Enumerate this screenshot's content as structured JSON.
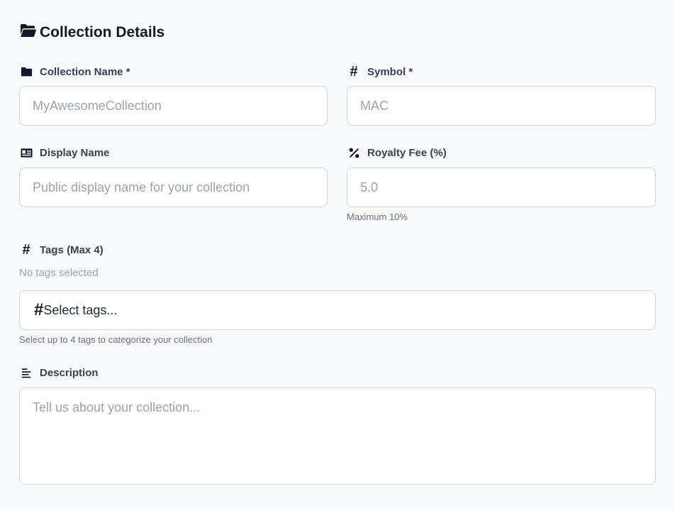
{
  "section": {
    "title": "Collection Details"
  },
  "fields": {
    "collection_name": {
      "label": "Collection Name *",
      "placeholder": "MyAwesomeCollection",
      "value": ""
    },
    "symbol": {
      "label": "Symbol *",
      "placeholder": "MAC",
      "value": ""
    },
    "display_name": {
      "label": "Display Name",
      "placeholder": "Public display name for your collection",
      "value": ""
    },
    "royalty_fee": {
      "label": "Royalty Fee (%)",
      "placeholder": "5.0",
      "value": "",
      "helper": "Maximum 10%"
    },
    "tags": {
      "label": "Tags (Max 4)",
      "empty_text": "No tags selected",
      "select_placeholder": "Select tags...",
      "helper": "Select up to 4 tags to categorize your collection"
    },
    "description": {
      "label": "Description",
      "placeholder": "Tell us about your collection...",
      "value": ""
    }
  },
  "icons": {
    "section": "folder-open-icon",
    "collection_name": "folder-icon",
    "symbol": "hash-icon",
    "display_name": "id-card-icon",
    "royalty_fee": "percent-icon",
    "tags": "hash-icon",
    "description": "align-left-icon"
  },
  "colors": {
    "background": "#f8f9fb",
    "border": "#d1d5db",
    "placeholder": "#9ca3af",
    "text": "#111827"
  }
}
